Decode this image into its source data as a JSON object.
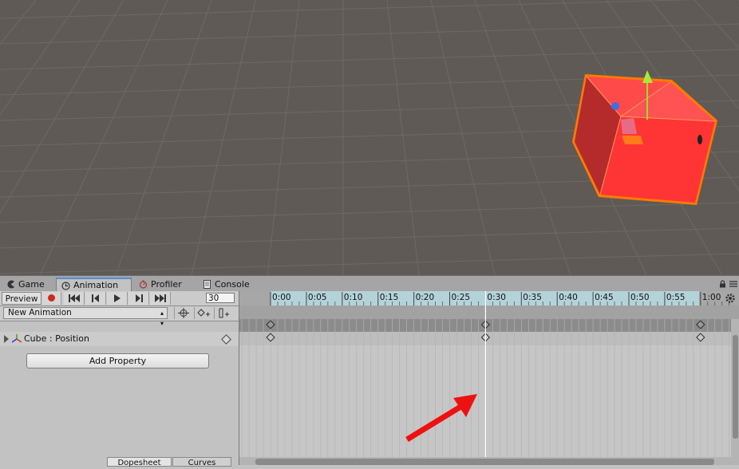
{
  "tabs": [
    {
      "label": "Game",
      "icon": "pacman-icon",
      "active": false
    },
    {
      "label": "Animation",
      "icon": "clock-icon",
      "active": true
    },
    {
      "label": "Profiler",
      "icon": "stopwatch-icon",
      "active": false
    },
    {
      "label": "Console",
      "icon": "console-icon",
      "active": false
    }
  ],
  "toolbar": {
    "preview_label": "Preview",
    "frame_value": "30",
    "record_color": "#cc2b1d"
  },
  "clip": {
    "selected": "New Animation"
  },
  "property": {
    "label": "Cube : Position"
  },
  "add_property_label": "Add Property",
  "bottom_tabs": {
    "dopesheet": "Dopesheet",
    "curves": "Curves"
  },
  "timeline": {
    "ruler_labels": [
      "0:00",
      "0:05",
      "0:10",
      "0:15",
      "0:20",
      "0:25",
      "0:30",
      "0:35",
      "0:40",
      "0:45",
      "0:50",
      "0:55",
      "1:00"
    ],
    "keyframe_times": [
      "0:00",
      "0:30",
      "1:00"
    ],
    "playhead_time": "0:30"
  },
  "colors": {
    "accent": "#5a8ad8",
    "selection_outline": "#ff7a00",
    "cube_red": "#ff3a3a",
    "arrow_red": "#ee1111",
    "ruler_bg": "#b3d3d9"
  }
}
